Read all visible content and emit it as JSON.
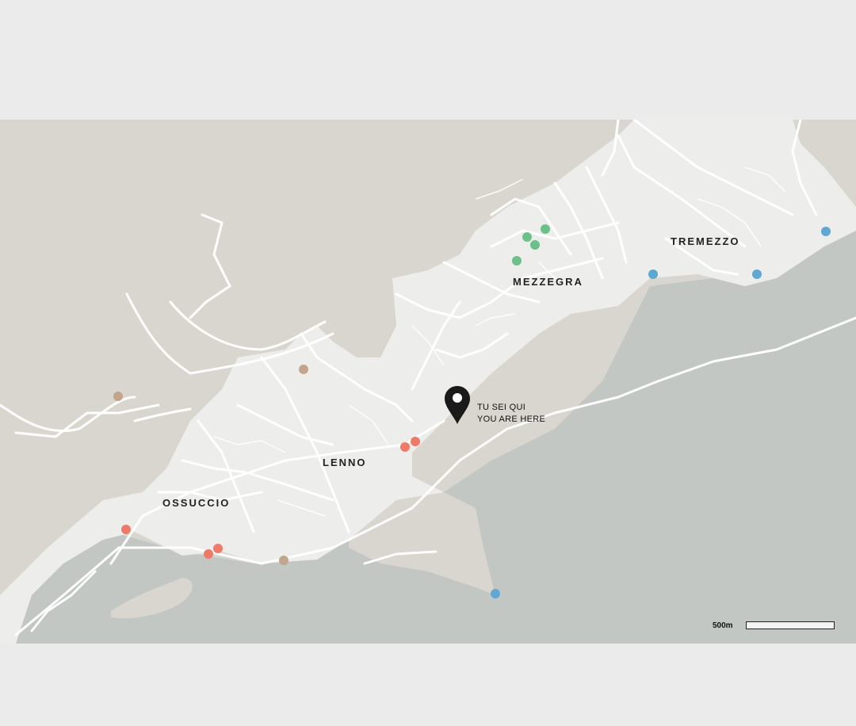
{
  "towns": {
    "tremezzo": "TREMEZZO",
    "mezzegra": "MEZZEGRA",
    "lenno": "LENNO",
    "ossuccio": "OSSUCCIO"
  },
  "you_are_here": {
    "line1": "TU SEI QUI",
    "line2": "YOU ARE HERE",
    "icon": "location-pin-icon"
  },
  "scale": {
    "label": "500m"
  },
  "colors": {
    "lake": "#c2c7c4",
    "land": "#d9d6cf",
    "urban": "#ededeb",
    "roads": "#ffffff",
    "marker_red": "#ef7a6a",
    "marker_green": "#6cc08a",
    "marker_blue": "#5fa8d3",
    "marker_tan": "#c2a58c"
  }
}
